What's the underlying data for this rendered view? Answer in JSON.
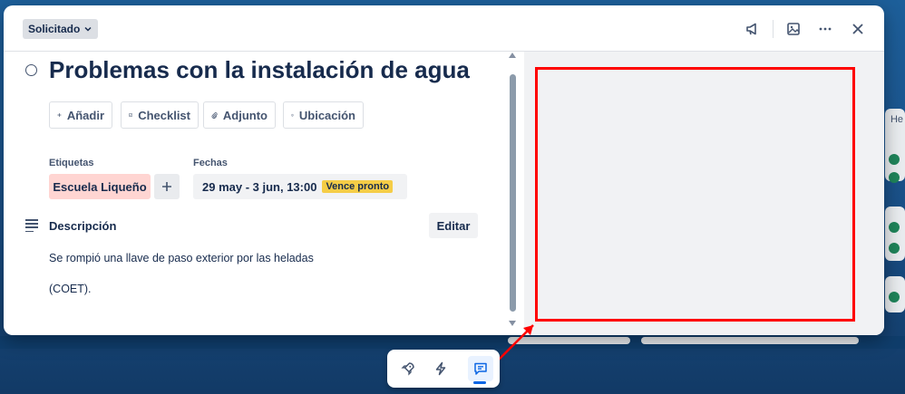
{
  "header": {
    "status_label": "Solicitado",
    "icons": [
      "megaphone-icon",
      "image-icon",
      "more-icon",
      "close-icon"
    ]
  },
  "card": {
    "title": "Problemas con la instalación de agua",
    "actions": [
      {
        "icon": "plus-icon",
        "label": "Añadir"
      },
      {
        "icon": "checklist-icon",
        "label": "Checklist"
      },
      {
        "icon": "paperclip-icon",
        "label": "Adjunto"
      },
      {
        "icon": "location-icon",
        "label": "Ubicación"
      }
    ],
    "labels_heading": "Etiquetas",
    "label_chip": "Escuela Liqueño",
    "dates_heading": "Fechas",
    "dates_value": "29 may - 3 jun, 13:00",
    "due_badge": "Vence pronto",
    "description_heading": "Descripción",
    "edit_label": "Editar",
    "description_lines": [
      "Se rompió una llave de paso exterior por las heladas",
      "(COET)."
    ]
  },
  "colors": {
    "highlight_box": "#ff0000",
    "label_chip": "#ffd5d2",
    "due_badge": "#f5cd47",
    "accent": "#0c66e4"
  },
  "dock": {
    "items": [
      "rocket-icon",
      "lightning-icon",
      "comment-icon"
    ],
    "active": "comment-icon"
  },
  "background": {
    "partial_text": "He"
  }
}
